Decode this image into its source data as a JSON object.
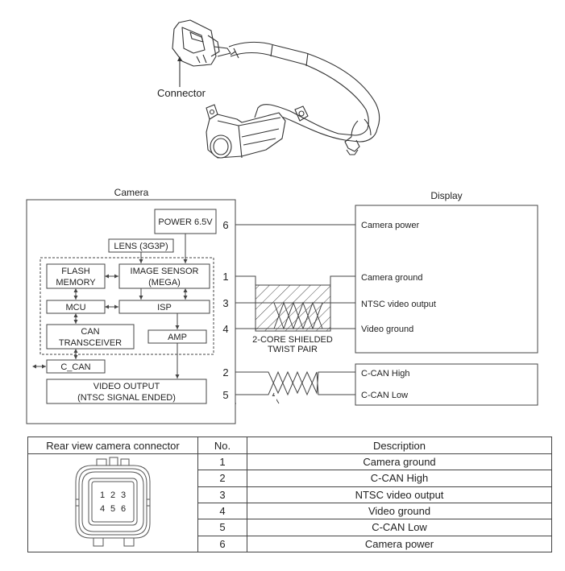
{
  "illustration": {
    "connector_label": "Connector"
  },
  "camera_block": {
    "title": "Camera",
    "modules": {
      "power": "POWER 6.5V",
      "lens": "LENS (3G3P)",
      "flash_memory": [
        "FLASH",
        "MEMORY"
      ],
      "image_sensor": [
        "IMAGE SENSOR",
        "(MEGA)"
      ],
      "mcu": "MCU",
      "isp": "ISP",
      "can_transceiver": [
        "CAN",
        "TRANSCEIVER"
      ],
      "amp": "AMP",
      "c_can": "C_CAN",
      "video_output": [
        "VIDEO OUTPUT",
        "(NTSC SIGNAL ENDED)"
      ]
    },
    "pin_labels": [
      "6",
      "1",
      "3",
      "4",
      "2",
      "5"
    ]
  },
  "cable": {
    "shield_label": [
      "2-CORE SHIELDED",
      "TWIST PAIR"
    ]
  },
  "display_block": {
    "title": "Display",
    "signals": [
      "Camera power",
      "Camera ground",
      "NTSC video output",
      "Video ground"
    ],
    "can_signals": [
      "C-CAN High",
      "C-CAN Low"
    ]
  },
  "pin_table": {
    "headers": [
      "Rear view camera connector",
      "No.",
      "Description"
    ],
    "connector_pins": [
      "1",
      "2",
      "3",
      "4",
      "5",
      "6"
    ],
    "rows": [
      {
        "no": "1",
        "description": "Camera ground"
      },
      {
        "no": "2",
        "description": "C-CAN High"
      },
      {
        "no": "3",
        "description": "NTSC video output"
      },
      {
        "no": "4",
        "description": "Video ground"
      },
      {
        "no": "5",
        "description": "C-CAN Low"
      },
      {
        "no": "6",
        "description": "Camera power"
      }
    ]
  }
}
